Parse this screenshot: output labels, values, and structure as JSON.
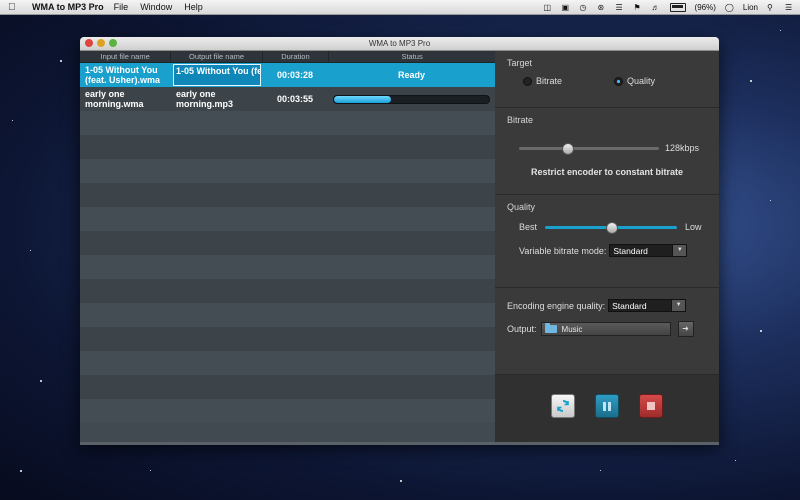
{
  "menubar": {
    "app_name": "WMA to MP3 Pro",
    "items": [
      "File",
      "Window",
      "Help"
    ],
    "battery": "(96%)",
    "user": "Lion"
  },
  "window": {
    "title": "WMA to MP3 Pro"
  },
  "table": {
    "columns": [
      "Input file name",
      "Output file name",
      "Duration",
      "Status"
    ],
    "rows": [
      {
        "input": "1-05 Without You (feat. Usher).wma",
        "output": "1-05 Without You (fe",
        "duration": "00:03:28",
        "status": "Ready",
        "progress": null
      },
      {
        "input": "early one morning.wma",
        "output": "early one morning.mp3",
        "duration": "00:03:55",
        "status": "",
        "progress": 0.37
      }
    ]
  },
  "target": {
    "title": "Target",
    "bitrate_label": "Bitrate",
    "quality_label": "Quality",
    "selected": "quality"
  },
  "bitrate": {
    "title": "Bitrate",
    "value": "128kbps",
    "slider_level": 0.34,
    "restrict_label": "Restrict encoder to constant bitrate"
  },
  "quality": {
    "title": "Quality",
    "best_label": "Best",
    "low_label": "Low",
    "slider_level": 0.5,
    "vbr_label": "Variable bitrate mode:",
    "vbr_value": "Standard"
  },
  "engine": {
    "label": "Encoding engine quality:",
    "value": "Standard",
    "output_label": "Output:",
    "output_value": "Music"
  },
  "colors": {
    "accent": "#1aa0cc",
    "stop": "#c43a3a"
  }
}
